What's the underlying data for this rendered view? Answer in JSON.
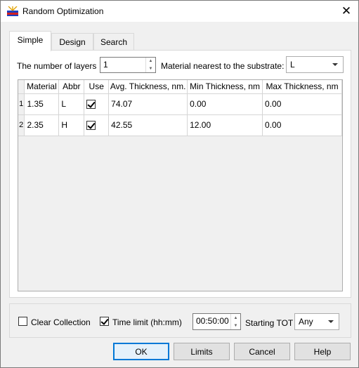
{
  "window": {
    "title": "Random Optimization",
    "close_glyph": "✕"
  },
  "tabs": [
    {
      "label": "Simple",
      "active": true
    },
    {
      "label": "Design",
      "active": false
    },
    {
      "label": "Search",
      "active": false
    }
  ],
  "simple": {
    "layers_label": "The number of layers",
    "layers_value": "1",
    "material_label": "Material nearest to the substrate:",
    "material_value": "L"
  },
  "table": {
    "columns": [
      "Material",
      "Abbr",
      "Use",
      "Avg. Thickness, nm.",
      "Min Thickness, nm",
      "Max Thickness, nm"
    ],
    "rows": [
      {
        "num": "1",
        "material": "1.35",
        "abbr": "L",
        "use": true,
        "avg": "74.07",
        "min": "0.00",
        "max": "0.00"
      },
      {
        "num": "2",
        "material": "2.35",
        "abbr": "H",
        "use": true,
        "avg": "42.55",
        "min": "12.00",
        "max": "0.00"
      }
    ]
  },
  "options": {
    "clear_collection_label": "Clear Collection",
    "clear_collection_checked": false,
    "time_limit_label": "Time limit (hh:mm)",
    "time_limit_checked": true,
    "time_value": "00:50:00",
    "starting_tot_label": "Starting TOT",
    "starting_tot_value": "Any"
  },
  "buttons": {
    "ok": "OK",
    "limits": "Limits",
    "cancel": "Cancel",
    "help": "Help"
  },
  "colors": {
    "accent": "#0078d7",
    "dialog_bg": "#f0f0f0",
    "grid_line": "#d5d5d5"
  }
}
